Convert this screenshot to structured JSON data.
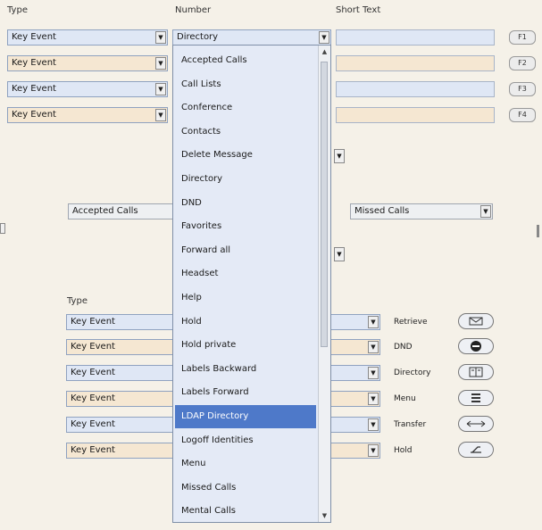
{
  "headers": {
    "type": "Type",
    "number": "Number",
    "short_text": "Short Text"
  },
  "top_rows": [
    {
      "type": "Key Event",
      "number": "Directory",
      "fkey": "F1"
    },
    {
      "type": "Key Event",
      "fkey": "F2"
    },
    {
      "type": "Key Event",
      "fkey": "F3"
    },
    {
      "type": "Key Event",
      "fkey": "F4"
    }
  ],
  "middle": {
    "left_select": "Accepted Calls",
    "right_select": "Missed Calls"
  },
  "bottom_header": "Type",
  "bottom_rows": [
    {
      "type": "Key Event",
      "label": "Retrieve",
      "icon": "envelope-icon"
    },
    {
      "type": "Key Event",
      "label": "DND",
      "icon": "no-entry-icon"
    },
    {
      "type": "Key Event",
      "label": "Directory",
      "icon": "book-icon"
    },
    {
      "type": "Key Event",
      "label": "Menu",
      "icon": "menu-icon"
    },
    {
      "type": "Key Event",
      "label": "Transfer",
      "icon": "double-arrow-icon"
    },
    {
      "type": "Key Event",
      "label": "Hold",
      "icon": "handset-icon"
    }
  ],
  "dropdown": {
    "items": [
      "Accepted Calls",
      "Call Lists",
      "Conference",
      "Contacts",
      "Delete Message",
      "Directory",
      "DND",
      "Favorites",
      "Forward all",
      "Headset",
      "Help",
      "Hold",
      "Hold private",
      "Labels Backward",
      "Labels Forward",
      "LDAP Directory",
      "Logoff Identities",
      "Menu",
      "Missed Calls",
      "Mental Calls"
    ],
    "highlighted": "LDAP Directory"
  },
  "colors": {
    "highlight": "#4e79c9",
    "field_blue": "#dfe7f5",
    "field_peach": "#f5e7d2"
  }
}
